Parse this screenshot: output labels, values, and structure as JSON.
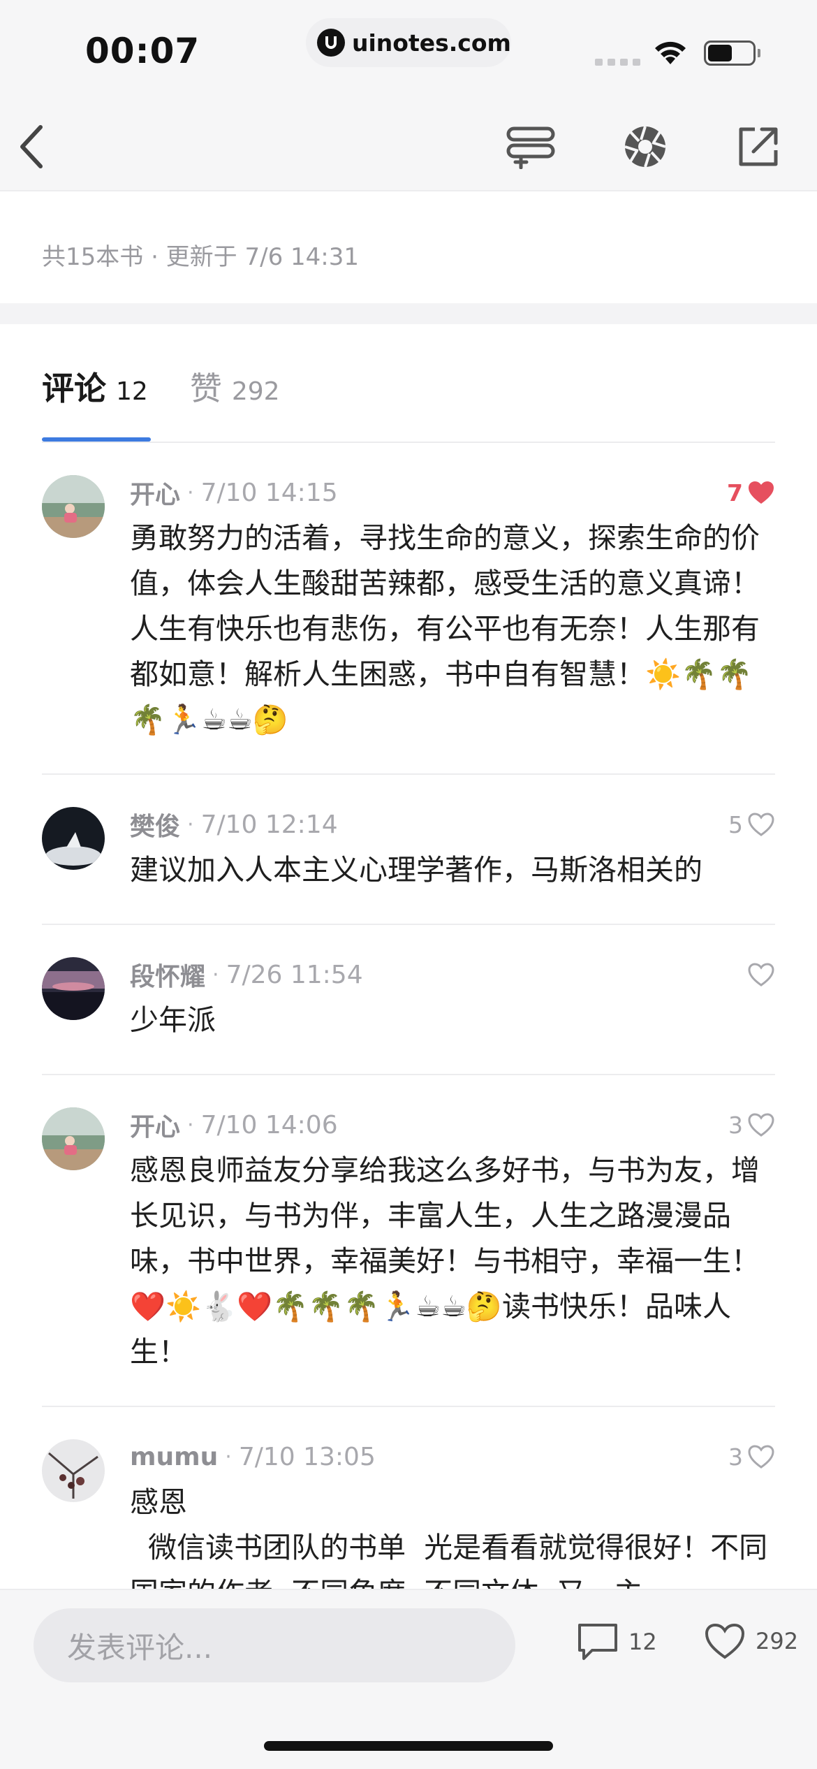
{
  "status_bar": {
    "time": "00:07",
    "url": "uinotes.com"
  },
  "nav": {
    "back_icon": "chevron-left-icon",
    "add_list_icon": "add-to-list-icon",
    "aperture_icon": "aperture-icon",
    "share_icon": "share-icon"
  },
  "summary": "共15本书 · 更新于 7/6 14:31",
  "tabs": [
    {
      "label": "评论",
      "count": "12"
    },
    {
      "label": "赞",
      "count": "292"
    }
  ],
  "comments": [
    {
      "name": "开心",
      "time": "7/10 14:15",
      "likes": "7",
      "liked": true,
      "text": "勇敢努力的活着，寻找生命的意义，探索生命的价值，体会人生酸甜苦辣都，感受生活的意义真谛！人生有快乐也有悲伤，有公平也有无奈！人生那有都如意！解析人生困惑，书中自有智慧！☀️🌴🌴🌴🏃☕☕🤔"
    },
    {
      "name": "樊俊",
      "time": "7/10 12:14",
      "likes": "5",
      "liked": false,
      "text": "建议加入人本主义心理学著作，马斯洛相关的"
    },
    {
      "name": "段怀耀",
      "time": "7/26 11:54",
      "likes": "",
      "liked": false,
      "text": "少年派"
    },
    {
      "name": "开心",
      "time": "7/10 14:06",
      "likes": "3",
      "liked": false,
      "text": "感恩良师益友分享给我这么多好书，与书为友，增长见识，与书为伴，丰富人生，人生之路漫漫品味，书中世界，幸福美好！与书相守，幸福一生！❤️☀️🐇❤️🌴🌴🌴🏃☕☕🤔读书快乐！品味人生！"
    },
    {
      "name": "mumu",
      "time": "7/10 13:05",
      "likes": "3",
      "liked": false,
      "text": "感恩\n  微信读书团队的书单  光是看看就觉得很好！不同国家的作者  不同角度  不同文体  又一主"
    }
  ],
  "bottom_bar": {
    "placeholder": "发表评论...",
    "comment_count": "12",
    "like_count": "292"
  }
}
